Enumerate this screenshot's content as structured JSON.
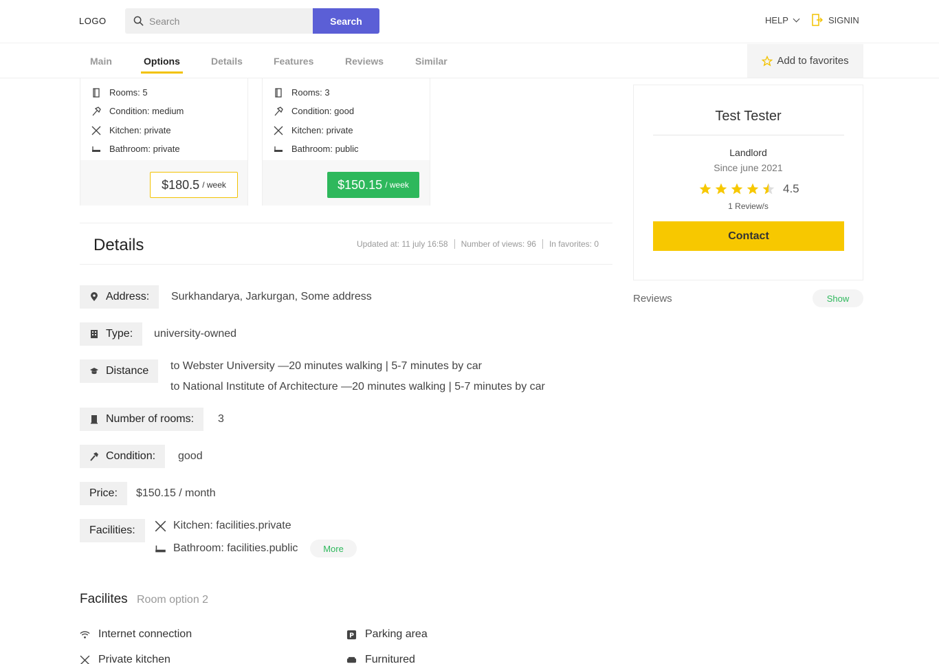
{
  "header": {
    "logo": "LOGO",
    "search_placeholder": "Search",
    "search_button": "Search",
    "help": "HELP",
    "signin": "SIGNIN"
  },
  "tabs": [
    {
      "label": "Main",
      "active": false
    },
    {
      "label": "Options",
      "active": true
    },
    {
      "label": "Details",
      "active": false
    },
    {
      "label": "Features",
      "active": false
    },
    {
      "label": "Reviews",
      "active": false
    },
    {
      "label": "Similar",
      "active": false
    }
  ],
  "favorites_button": "Add to favorites",
  "room_options": [
    {
      "rooms": "Rooms: 5",
      "condition": "Condition: medium",
      "kitchen": "Kitchen: private",
      "bathroom": "Bathroom: private",
      "price": "$180.5",
      "period": "/ week"
    },
    {
      "rooms": "Rooms: 3",
      "condition": "Condition: good",
      "kitchen": "Kitchen: private",
      "bathroom": "Bathroom: public",
      "price": "$150.15",
      "period": "/ week"
    }
  ],
  "details": {
    "title": "Details",
    "updated": "Updated at: 11 july 16:58",
    "views": "Number of views: 96",
    "favorites": "In favorites: 0",
    "address_label": "Address:",
    "address_value": "Surkhandarya, Jarkurgan, Some address",
    "type_label": "Type:",
    "type_value": "university-owned",
    "distance_label": "Distance",
    "distance_1": "to Webster University —20 minutes walking | 5-7 minutes by car",
    "distance_2": "to National Institute of Architecture —20 minutes walking | 5-7 minutes by car",
    "rooms_label": "Number of rooms:",
    "rooms_value": "3",
    "condition_label": "Condition:",
    "condition_value": "good",
    "price_label": "Price:",
    "price_value": "$150.15 / month",
    "facilities_label": "Facilities:",
    "facility_kitchen": "Kitchen: facilities.private",
    "facility_bathroom": "Bathroom: facilities.public",
    "more": "More"
  },
  "facilities_section": {
    "title": "Facilites",
    "subtitle": "Room option 2",
    "items": [
      "Internet connection",
      "Parking area",
      "Private kitchen",
      "Furnitured"
    ]
  },
  "landlord": {
    "name": "Test Tester",
    "role": "Landlord",
    "since": "Since june 2021",
    "rating": "4.5",
    "rating_value": 4.5,
    "reviews_count": "1 Review/s",
    "contact": "Contact"
  },
  "reviews": {
    "label": "Reviews",
    "show": "Show"
  },
  "colors": {
    "accent": "#5b5fd6",
    "yellow": "#f7c800",
    "green": "#2eb85c"
  }
}
